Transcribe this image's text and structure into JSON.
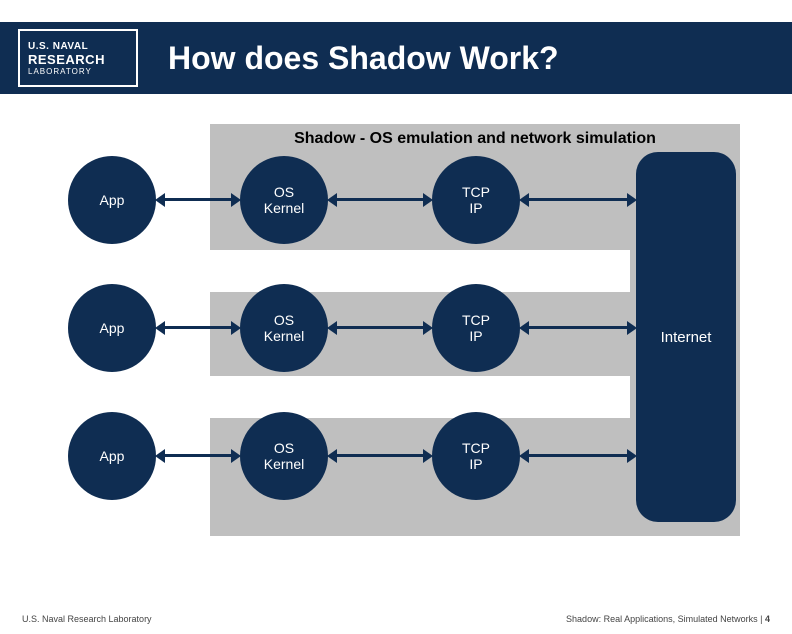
{
  "header": {
    "logo_line1": "U.S. NAVAL",
    "logo_line2": "RESEARCH",
    "logo_line3": "LABORATORY",
    "title": "How does Shadow Work?"
  },
  "diagram": {
    "shadow_label": "Shadow - OS emulation and network simulation",
    "internet": "Internet",
    "rows": [
      {
        "app": "App",
        "kernel_l1": "OS",
        "kernel_l2": "Kernel",
        "tcp_l1": "TCP",
        "tcp_l2": "IP"
      },
      {
        "app": "App",
        "kernel_l1": "OS",
        "kernel_l2": "Kernel",
        "tcp_l1": "TCP",
        "tcp_l2": "IP"
      },
      {
        "app": "App",
        "kernel_l1": "OS",
        "kernel_l2": "Kernel",
        "tcp_l1": "TCP",
        "tcp_l2": "IP"
      }
    ]
  },
  "footer": {
    "left": "U.S. Naval Research Laboratory",
    "right_prefix": "Shadow: Real Applications, Simulated Networks  |  ",
    "page": "4"
  }
}
